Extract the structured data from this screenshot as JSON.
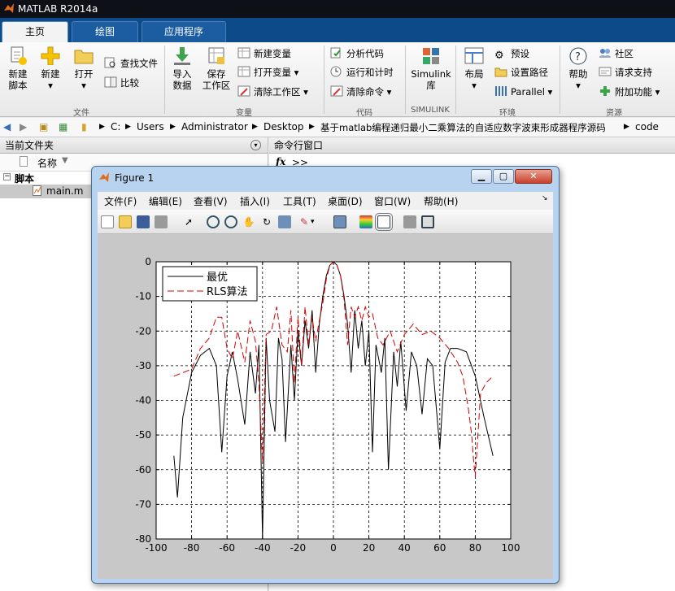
{
  "app": {
    "title": "MATLAB R2014a"
  },
  "tabs": [
    {
      "label": "主页"
    },
    {
      "label": "绘图"
    },
    {
      "label": "应用程序"
    }
  ],
  "ribbon": {
    "new_script": "新建\n脚本",
    "new": "新建",
    "open": "打开",
    "find_files": "查找文件",
    "compare": "比较",
    "import_data": "导入\n数据",
    "save_workspace": "保存\n工作区",
    "new_variable": "新建变量",
    "open_variable": "打开变量",
    "clear_workspace": "清除工作区",
    "analyze_code": "分析代码",
    "run_and_time": "运行和计时",
    "clear_commands": "清除命令",
    "simulink": "Simulink\n库",
    "layout": "布局",
    "preferences": "预设",
    "set_path": "设置路径",
    "parallel": "Parallel",
    "help": "帮助",
    "community": "社区",
    "request_support": "请求支持",
    "addons": "附加功能",
    "groups": {
      "file": "文件",
      "variable": "变量",
      "code": "代码",
      "simulink": "SIMULINK",
      "environment": "环境",
      "resources": "资源"
    }
  },
  "address": {
    "crumbs": [
      "C:",
      "Users",
      "Administrator",
      "Desktop",
      "基于matlab编程递归最小二乘算法的自适应数字波束形成器程序源码",
      "code"
    ]
  },
  "left_panel": {
    "title": "当前文件夹",
    "column": "名称",
    "folder": "脚本",
    "file": "main.m"
  },
  "right_panel": {
    "title": "命令行窗口",
    "prompt": ">>",
    "fx": "fx"
  },
  "figure": {
    "title": "Figure 1",
    "menu": [
      "文件(F)",
      "编辑(E)",
      "查看(V)",
      "插入(I)",
      "工具(T)",
      "桌面(D)",
      "窗口(W)",
      "帮助(H)"
    ]
  },
  "chart_data": {
    "type": "line",
    "title": "",
    "xlabel": "",
    "ylabel": "",
    "xlim": [
      -100,
      100
    ],
    "ylim": [
      -80,
      0
    ],
    "xticks": [
      -100,
      -80,
      -60,
      -40,
      -20,
      0,
      20,
      40,
      60,
      80,
      100
    ],
    "yticks": [
      0,
      -10,
      -20,
      -30,
      -40,
      -50,
      -60,
      -70,
      -80
    ],
    "grid": true,
    "legend_position": "top-left",
    "series": [
      {
        "name": "最优",
        "color": "#000000",
        "dash": "solid",
        "x": [
          -90,
          -88,
          -85,
          -80,
          -75,
          -70,
          -66,
          -63,
          -60,
          -57,
          -54,
          -50,
          -47,
          -44,
          -42,
          -40,
          -38,
          -36,
          -33,
          -31,
          -29,
          -27,
          -24,
          -22,
          -20,
          -18,
          -16,
          -14,
          -12,
          -10,
          -8,
          -6,
          -4,
          -2,
          0,
          2,
          4,
          6,
          8,
          10,
          12,
          14,
          16,
          18,
          20,
          22,
          24,
          27,
          29,
          31,
          34,
          36,
          38,
          41,
          44,
          47,
          50,
          53,
          56,
          60,
          63,
          66,
          70,
          75,
          80,
          85,
          90
        ],
        "y": [
          -56,
          -68,
          -45,
          -32,
          -27,
          -25,
          -30,
          -55,
          -33,
          -26,
          -34,
          -47,
          -26,
          -38,
          -24,
          -80,
          -22,
          -40,
          -49,
          -22,
          -28,
          -52,
          -24,
          -40,
          -20,
          -30,
          -17,
          -25,
          -14,
          -32,
          -18,
          -10,
          -4,
          -1,
          0,
          -1,
          -4,
          -10,
          -18,
          -32,
          -14,
          -25,
          -17,
          -30,
          -20,
          -55,
          -24,
          -32,
          -22,
          -60,
          -26,
          -36,
          -23,
          -43,
          -26,
          -30,
          -44,
          -28,
          -30,
          -54,
          -29,
          -25,
          -25,
          -26,
          -33,
          -45,
          -56
        ]
      },
      {
        "name": "RLS算法",
        "color": "#d40000",
        "dash": "dashed",
        "x": [
          -90,
          -85,
          -80,
          -75,
          -70,
          -66,
          -63,
          -60,
          -57,
          -54,
          -50,
          -47,
          -44,
          -42,
          -40,
          -38,
          -35,
          -32,
          -29,
          -26,
          -24,
          -22,
          -20,
          -18,
          -16,
          -14,
          -12,
          -10,
          -8,
          -6,
          -4,
          -2,
          0,
          2,
          4,
          6,
          8,
          10,
          12,
          14,
          16,
          18,
          20,
          22,
          25,
          28,
          32,
          36,
          40,
          45,
          50,
          55,
          60,
          65,
          70,
          73,
          76,
          78,
          79,
          80,
          81,
          83,
          86,
          90
        ],
        "y": [
          -33,
          -32,
          -31,
          -25,
          -22,
          -16,
          -16,
          -25,
          -28,
          -20,
          -29,
          -17,
          -23,
          -35,
          -58,
          -21,
          -20,
          -13,
          -24,
          -26,
          -14,
          -35,
          -16,
          -30,
          -13,
          -24,
          -16,
          -23,
          -17,
          -12,
          -5,
          -1,
          0,
          -1,
          -4,
          -11,
          -24,
          -13,
          -16,
          -13,
          -17,
          -13,
          -16,
          -15,
          -22,
          -24,
          -20,
          -26,
          -21,
          -18,
          -21,
          -20,
          -22,
          -25,
          -29,
          -33,
          -42,
          -50,
          -57,
          -62,
          -54,
          -38,
          -35,
          -33
        ]
      }
    ]
  }
}
